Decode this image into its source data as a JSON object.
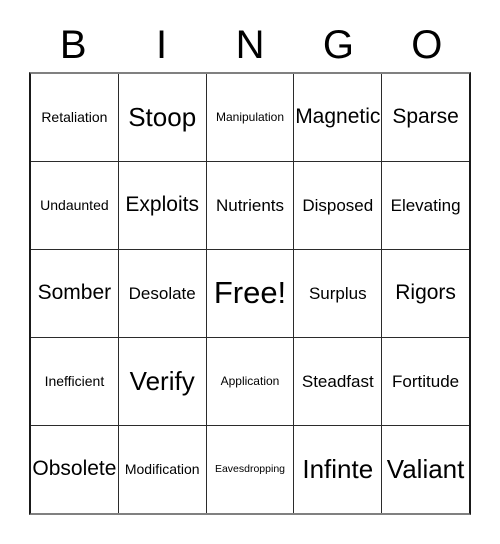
{
  "card": {
    "header": {
      "letters": [
        "B",
        "I",
        "N",
        "G",
        "O"
      ]
    },
    "grid": {
      "rows": [
        [
          {
            "label": "Retaliation",
            "size": "sm"
          },
          {
            "label": "Stoop",
            "size": "xl"
          },
          {
            "label": "Manipulation",
            "size": "xs"
          },
          {
            "label": "Magnetic",
            "size": "lg"
          },
          {
            "label": "Sparse",
            "size": "lg"
          }
        ],
        [
          {
            "label": "Undaunted",
            "size": "sm"
          },
          {
            "label": "Exploits",
            "size": "lg"
          },
          {
            "label": "Nutrients",
            "size": "md"
          },
          {
            "label": "Disposed",
            "size": "md"
          },
          {
            "label": "Elevating",
            "size": "md"
          }
        ],
        [
          {
            "label": "Somber",
            "size": "lg"
          },
          {
            "label": "Desolate",
            "size": "md"
          },
          {
            "label": "Free!",
            "size": "xxl"
          },
          {
            "label": "Surplus",
            "size": "md"
          },
          {
            "label": "Rigors",
            "size": "lg"
          }
        ],
        [
          {
            "label": "Inefficient",
            "size": "sm"
          },
          {
            "label": "Verify",
            "size": "xl"
          },
          {
            "label": "Application",
            "size": "xs"
          },
          {
            "label": "Steadfast",
            "size": "md"
          },
          {
            "label": "Fortitude",
            "size": "md"
          }
        ],
        [
          {
            "label": "Obsolete",
            "size": "lg"
          },
          {
            "label": "Modification",
            "size": "sm"
          },
          {
            "label": "Eavesdropping",
            "size": "xxs"
          },
          {
            "label": "Infinte",
            "size": "xl"
          },
          {
            "label": "Valiant",
            "size": "xl"
          }
        ]
      ]
    },
    "colors": {
      "background": "#ffffff",
      "text": "#000000",
      "grid_line": "#2b2b2b",
      "outer_border": "#1a1a1a"
    }
  }
}
